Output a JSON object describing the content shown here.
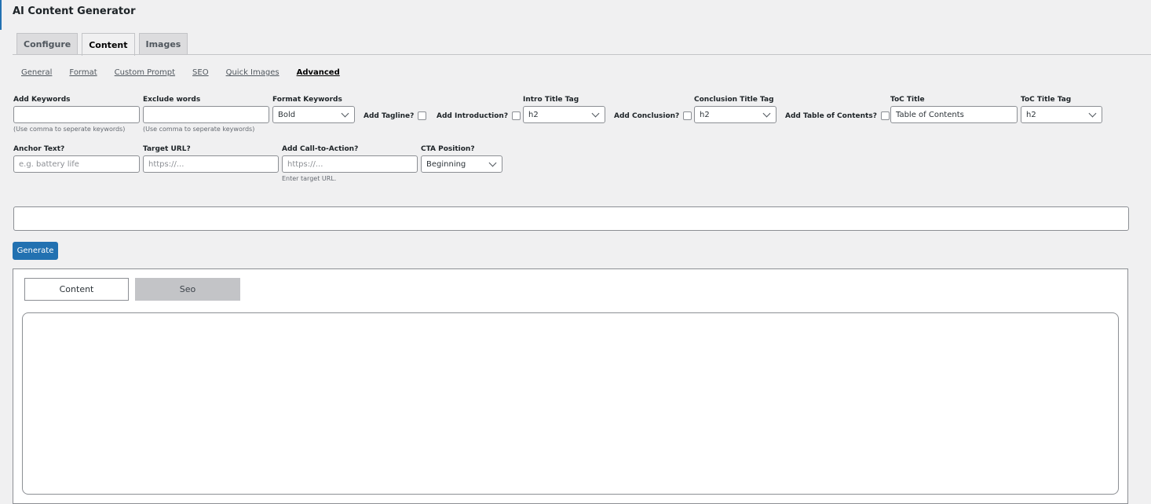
{
  "app": {
    "title": "AI Content Generator"
  },
  "tabs": [
    {
      "label": "Configure"
    },
    {
      "label": "Content"
    },
    {
      "label": "Images"
    }
  ],
  "subnav": [
    {
      "label": "General"
    },
    {
      "label": "Format"
    },
    {
      "label": "Custom Prompt"
    },
    {
      "label": "SEO"
    },
    {
      "label": "Quick Images"
    },
    {
      "label": "Advanced"
    }
  ],
  "fields": {
    "add_keywords": {
      "label": "Add Keywords",
      "value": "",
      "help": "(Use comma to seperate keywords)"
    },
    "exclude_words": {
      "label": "Exclude words",
      "value": "",
      "help": "(Use comma to seperate keywords)"
    },
    "format_keywords": {
      "label": "Format Keywords",
      "selected": "Bold"
    },
    "add_tagline": {
      "label": "Add Tagline?"
    },
    "add_introduction": {
      "label": "Add Introduction?"
    },
    "intro_title_tag": {
      "label": "Intro Title Tag",
      "selected": "h2"
    },
    "add_conclusion": {
      "label": "Add Conclusion?"
    },
    "conclusion_title_tag": {
      "label": "Conclusion Title Tag",
      "selected": "h2"
    },
    "add_toc": {
      "label": "Add Table of Contents?"
    },
    "toc_title": {
      "label": "ToC Title",
      "value": "Table of Contents"
    },
    "toc_title_tag": {
      "label": "ToC Title Tag",
      "selected": "h2"
    },
    "anchor_text": {
      "label": "Anchor Text?",
      "placeholder": "e.g. battery life"
    },
    "target_url": {
      "label": "Target URL?",
      "placeholder": "https://..."
    },
    "cta": {
      "label": "Add Call-to-Action?",
      "placeholder": "https://...",
      "help": "Enter target URL."
    },
    "cta_position": {
      "label": "CTA Position?",
      "selected": "Beginning"
    }
  },
  "actions": {
    "generate_label": "Generate"
  },
  "output": {
    "tabs": [
      {
        "label": "Content"
      },
      {
        "label": "Seo"
      }
    ]
  },
  "colors": {
    "primary": "#2271b1",
    "background": "#f0f0f1"
  }
}
